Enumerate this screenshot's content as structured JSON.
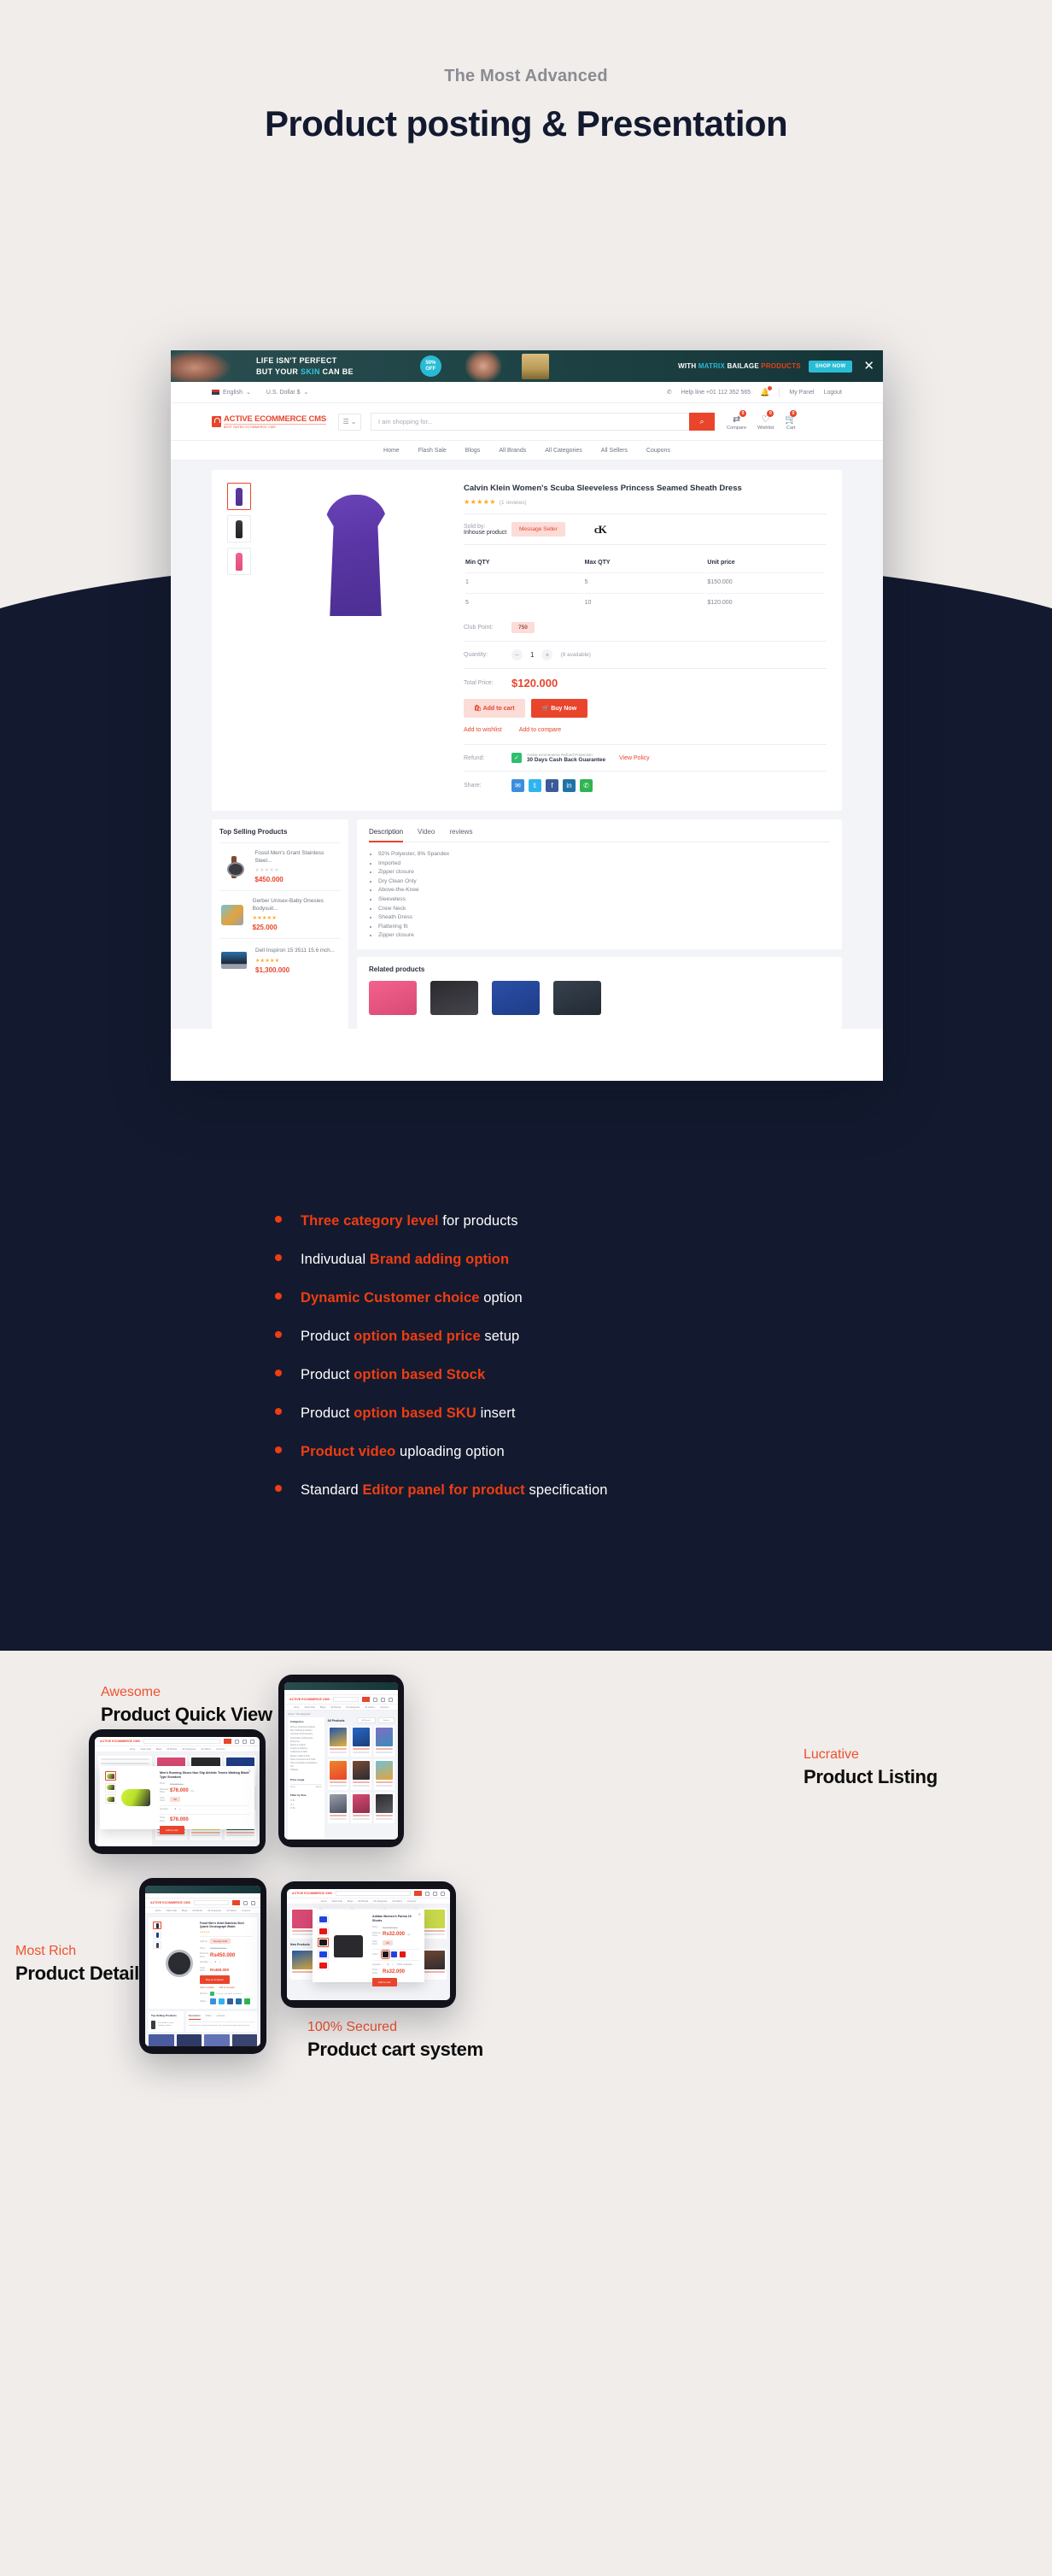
{
  "hero": {
    "eyebrow": "The Most Advanced",
    "title": "Product posting & Presentation"
  },
  "features": [
    {
      "pre": "",
      "strong": "Three  category level",
      "post": " for products"
    },
    {
      "pre": "Indivudual ",
      "strong": "Brand adding option",
      "post": ""
    },
    {
      "pre": "",
      "strong": "Dynamic Customer choice",
      "post": " option"
    },
    {
      "pre": "Product ",
      "strong": "option based price",
      "post": " setup"
    },
    {
      "pre": "Product ",
      "strong": "option based Stock",
      "post": ""
    },
    {
      "pre": "Product ",
      "strong": "option based SKU",
      "post": " insert"
    },
    {
      "pre": "",
      "strong": "Product video",
      "post": " uploading option"
    },
    {
      "pre": "Standard ",
      "strong": "Editor panel for product",
      "post": " specification"
    }
  ],
  "browser": {
    "promo": {
      "line1": "LIFE ISN'T PERFECT",
      "line2_a": "BUT YOUR ",
      "line2_hl": "SKIN",
      "line2_b": " CAN BE",
      "badge_top": "50%",
      "badge_bottom": "OFF",
      "right_a": "WITH ",
      "right_brand": "MATRIX",
      "right_b": " BAILAGE ",
      "right_c": "PRODUCTS",
      "shop_now": "SHOP NOW",
      "close": "✕"
    },
    "topbar": {
      "language": "English",
      "currency": "U.S. Dollar $",
      "helpline": "Help line +01 112 352 565",
      "my_panel": "My Panel",
      "logout": "Logout"
    },
    "header": {
      "logo_title": "ACTIVE ECOMMERCE CMS",
      "logo_sub": "BEST RATED ECOMMERCE CMS",
      "search_placeholder": "I am shopping for...",
      "icons": [
        {
          "name": "Compare",
          "count": "0"
        },
        {
          "name": "Wishlist",
          "count": "0"
        },
        {
          "name": "Cart",
          "count": "0"
        }
      ]
    },
    "nav": [
      "Home",
      "Flash Sale",
      "Blogs",
      "All Brands",
      "All Categories",
      "All Sellers",
      "Coupons"
    ],
    "product": {
      "title": "Calvin Klein Women's Scuba Sleeveless Princess Seamed Sheath Dress",
      "reviews": "(1 reviews)",
      "sold_by_label": "Sold by:",
      "sold_by_value": "Inhouse product",
      "message_seller": "Message Seller",
      "brand": "cK",
      "qty_table": {
        "headers": [
          "Min QTY",
          "Max QTY",
          "Unit price"
        ],
        "rows": [
          [
            "1",
            "5",
            "$150.000"
          ],
          [
            "5",
            "10",
            "$120.000"
          ]
        ]
      },
      "club_point_label": "Club Point:",
      "club_point_value": "750",
      "quantity_label": "Quantity:",
      "quantity_value": "1",
      "available": "(9 available)",
      "total_price_label": "Total Price:",
      "total_price_value": "$120.000",
      "add_to_cart": "Add to cart",
      "buy_now": "Buy Now",
      "add_to_wishlist": "Add to wishlist",
      "add_to_compare": "Add to compare",
      "refund_label": "Refund:",
      "refund_small": "Active eCommerce Refund Protection",
      "refund_big": "30 Days Cash Back Guarantee",
      "view_policy": "View Policy",
      "share_label": "Share:"
    },
    "top_selling": {
      "heading": "Top Selling Products",
      "items": [
        {
          "name": "Fossil Men's Grant Stainless Steel...",
          "price": "$450.000",
          "rated": false
        },
        {
          "name": "Gerber Unisex-Baby Onesies Bodysuit...",
          "price": "$25.000",
          "rated": true
        },
        {
          "name": "Dell Inspiron 15 3511 15.6 inch...",
          "price": "$1,300.000",
          "rated": true
        }
      ]
    },
    "tabs": [
      "Description",
      "Video",
      "reviews"
    ],
    "description": [
      "92% Polyester, 8% Spandex",
      "Imported",
      "Zipper closure",
      "Dry Clean Only",
      "Above-the-Knee",
      "Sleeveless",
      "Crew Neck",
      "Sheath Dress",
      "Flattering fit",
      "Zipper closure"
    ],
    "related_heading": "Related products"
  },
  "showcase": {
    "quick_view": {
      "eyebrow": "Awesome",
      "title": "Product Quick View",
      "modal": {
        "product_title": "Men's Running Shoes Non Slip Athletic Tennis Walking Blade Type Sneakers",
        "price_label": "Price:",
        "price_old": "$95.000 /pc",
        "discount_label": "Discount Price:",
        "price_new": "$76.000",
        "price_unit": "/pc",
        "club_label": "Club Point:",
        "club_value": "350",
        "qty_label": "Quantity:",
        "qty_value": "1",
        "total_label": "Total Price:",
        "total_value": "$76.000",
        "add_to_cart": "Add to cart",
        "close": "✕"
      },
      "page_section": "Flash Sale",
      "view_more": "View More"
    },
    "listing": {
      "eyebrow": "Lucrative",
      "title": "Product Listing",
      "breadcrumb": "Home / \"All Categories\"",
      "heading": "All Products",
      "filter_brands_label": "Brands",
      "filter_brands_value": "All Brands",
      "filter_sort_label": "Sort by",
      "filter_sort_value": "Newest",
      "categories_heading": "Categories",
      "categories": [
        "Women Clothing & Fashion",
        "Men Clothing & Fashion",
        "Computer & Accessories",
        "Automobile & Motorcycle",
        "Kids & toy",
        "Sports & outdoor",
        "Jewelry & Watches",
        "Cellphones & Tabs",
        "Beauty, Health & Hair",
        "Home Improvement & Tools",
        "Home decoration & Appliance",
        "Toy",
        "Software"
      ],
      "price_range_heading": "Price range",
      "price_min": "$0.00",
      "price_max": "$99.00",
      "size_heading": "Filter by Size",
      "sizes": [
        "M",
        "L",
        "XL"
      ]
    },
    "detail": {
      "eyebrow": "Most Rich",
      "title": "Product Detail",
      "product_title": "Fossil Men's Grant Stainless Steel Quartz Chronograph Watch",
      "price_old": "Rs650.000 /pc",
      "price_new": "Rs450.000",
      "qty_value": "1",
      "total": "Rs450.000",
      "buy_button": "Buy on Amazon",
      "wishlist": "Add to wishlist",
      "compare": "Add to compare",
      "tabs": [
        "Description",
        "Video",
        "reviews"
      ],
      "top_selling": "Top Selling Products"
    },
    "cart": {
      "eyebrow": "100% Secured",
      "title": "Product cart system",
      "modal": {
        "product_title": "Adidas Women's Parma 16 Shorts",
        "price_label": "Price:",
        "price_old": "Rs49.000 /pc",
        "discount_label": "Discount Price:",
        "price_new": "Rs32.000",
        "price_unit": "/pc",
        "club_label": "Club Point:",
        "club_value": "200",
        "color_label": "Color:",
        "colors": [
          "#18181b",
          "#1f45e0",
          "#e51717"
        ],
        "qty_label": "Quantity:",
        "qty_value": "1",
        "available": "(5000 available)",
        "total_label": "Total Price:",
        "total_value": "Rs32.000",
        "add_to_cart": "Add to cart",
        "close": "✕"
      },
      "new_products": "New Products"
    }
  },
  "colors": {
    "accent": "#f03d11",
    "navy": "#131a2f",
    "page_bg": "#f0edeb",
    "shop_red": "#e8452c"
  }
}
